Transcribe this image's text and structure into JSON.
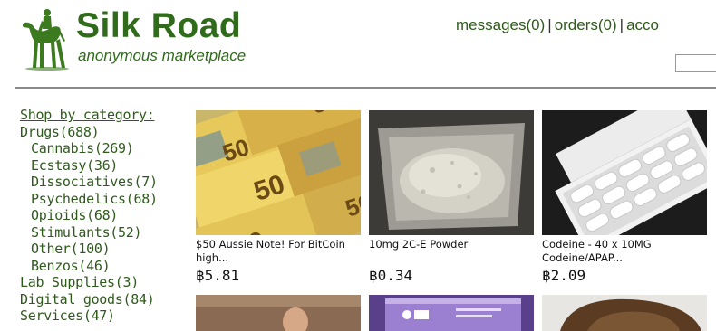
{
  "header": {
    "logo": "camel-rider-logo-icon",
    "title": "Silk Road",
    "tagline": "anonymous marketplace",
    "nav": {
      "messages": "messages(0)",
      "orders": "orders(0)",
      "account": "acco",
      "separator": "|"
    },
    "search": {
      "placeholder": ""
    }
  },
  "sidebar": {
    "heading": "Shop by category:",
    "categories": [
      {
        "label": "Drugs(688)",
        "level": 0
      },
      {
        "label": "Cannabis(269)",
        "level": 1
      },
      {
        "label": "Ecstasy(36)",
        "level": 1
      },
      {
        "label": "Dissociatives(7)",
        "level": 1
      },
      {
        "label": "Psychedelics(68)",
        "level": 1
      },
      {
        "label": "Opioids(68)",
        "level": 1
      },
      {
        "label": "Stimulants(52)",
        "level": 1
      },
      {
        "label": "Other(100)",
        "level": 1
      },
      {
        "label": "Benzos(46)",
        "level": 1
      },
      {
        "label": "Lab Supplies(3)",
        "level": 0
      },
      {
        "label": "Digital goods(84)",
        "level": 0
      },
      {
        "label": "Services(47)",
        "level": 0
      }
    ]
  },
  "listings": [
    {
      "title": "$50 Aussie Note! For BitCoin high...",
      "price": "฿5.81",
      "image": "aussie-banknotes"
    },
    {
      "title": "10mg 2C-E Powder",
      "price": "฿0.34",
      "image": "white-powder-dish"
    },
    {
      "title": "Codeine - 40 x 10MG Codeine/APAP...",
      "price": "฿2.09",
      "image": "pill-blister-pack"
    }
  ],
  "colors": {
    "brand_green": "#2f6b1a",
    "link_green": "#2f5a1c",
    "divider": "#8a8a8a"
  }
}
